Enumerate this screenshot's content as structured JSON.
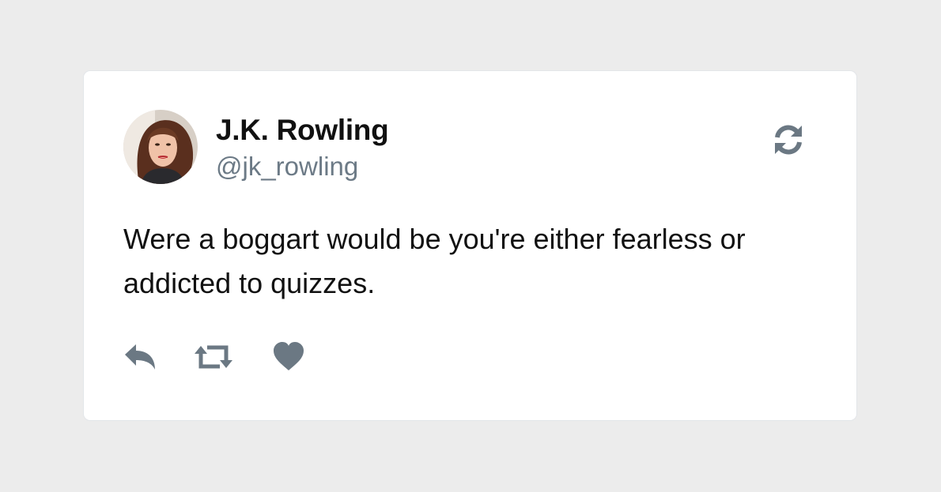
{
  "tweet": {
    "author_name": "J.K. Rowling",
    "author_handle": "@jk_rowling",
    "text": "Were a boggart would be you're either fearless or addicted to quizzes."
  },
  "icons": {
    "header": "refresh-icon",
    "actions": [
      "reply-icon",
      "retweet-icon",
      "like-icon"
    ]
  },
  "colors": {
    "background": "#ececec",
    "card": "#ffffff",
    "text": "#111111",
    "muted": "#6c7a86",
    "icon": "#6b7883"
  }
}
